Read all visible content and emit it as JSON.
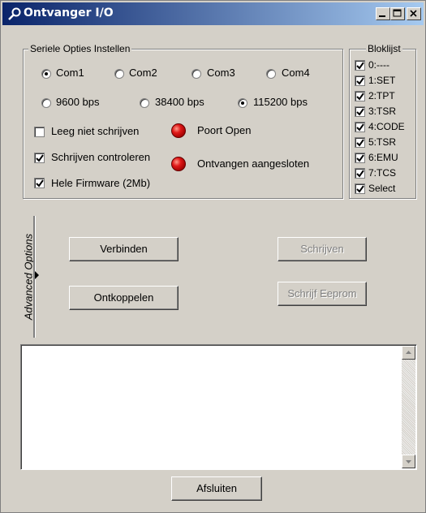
{
  "window": {
    "title": "Ontvanger I/O"
  },
  "serial": {
    "legend": "Seriele Opties Instellen",
    "ports": [
      {
        "label": "Com1",
        "selected": true
      },
      {
        "label": "Com2",
        "selected": false
      },
      {
        "label": "Com3",
        "selected": false
      },
      {
        "label": "Com4",
        "selected": false
      }
    ],
    "bauds": [
      {
        "label": "9600 bps",
        "selected": false
      },
      {
        "label": "38400 bps",
        "selected": false
      },
      {
        "label": "115200 bps",
        "selected": true
      }
    ],
    "options": [
      {
        "label": "Leeg niet schrijven",
        "checked": false
      },
      {
        "label": "Schrijven controleren",
        "checked": true
      },
      {
        "label": "Hele Firmware (2Mb)",
        "checked": true
      }
    ],
    "indicators": [
      {
        "label": "Poort Open",
        "color": "#e01818"
      },
      {
        "label": "Ontvangen aangesloten",
        "color": "#e01818"
      }
    ]
  },
  "bloklijst": {
    "legend": "Bloklijst",
    "items": [
      "0:----",
      "1:SET",
      "2:TPT",
      "3:TSR",
      "4:CODE",
      "5:TSR",
      "6:EMU",
      "7:TCS",
      "Select"
    ]
  },
  "advanced": {
    "label": "Advanced Options"
  },
  "buttons": {
    "connect": "Verbinden",
    "disconnect": "Ontkoppelen",
    "write": "Schrijven",
    "write_eeprom": "Schrijf Eeprom",
    "close": "Afsluiten"
  },
  "log": {
    "value": ""
  }
}
